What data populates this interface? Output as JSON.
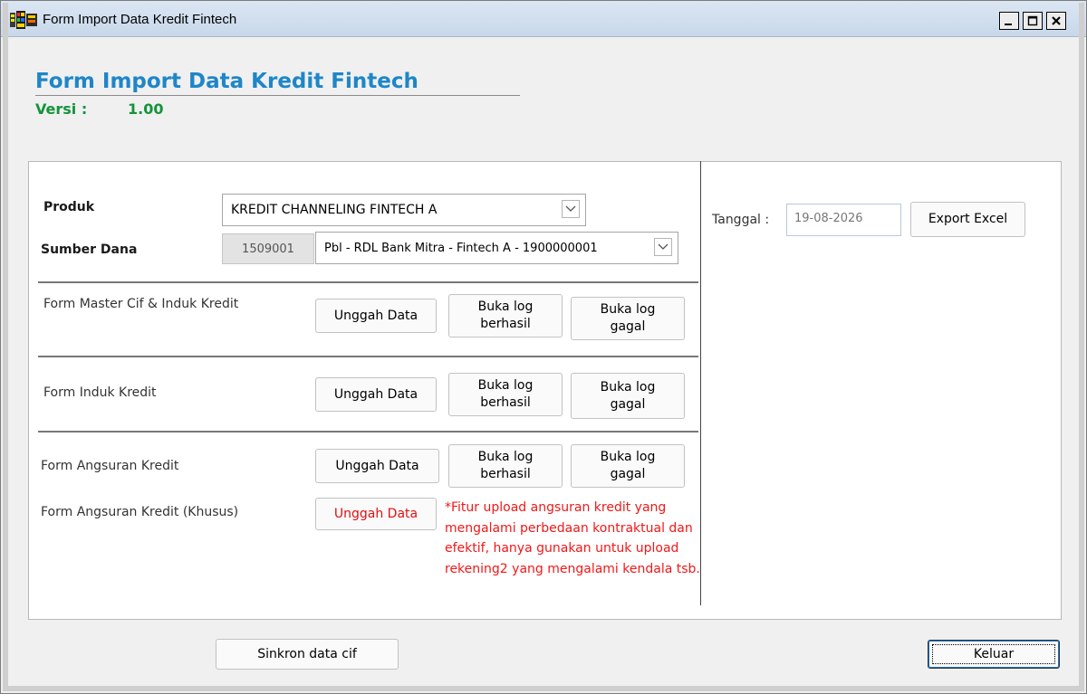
{
  "window": {
    "title": "Form Import Data Kredit Fintech"
  },
  "header": {
    "title": "Form Import Data Kredit Fintech",
    "versi_label": "Versi :",
    "versi_value": "1.00"
  },
  "form": {
    "produk_label": "Produk",
    "produk_value": "KREDIT CHANNELING FINTECH A",
    "sumber_dana_label": "Sumber Dana",
    "sumber_dana_code": "1509001",
    "sumber_dana_value": "Pbl - RDL Bank Mitra - Fintech A - 1900000001"
  },
  "sections": {
    "master": {
      "label": "Form Master Cif & Induk Kredit",
      "upload": "Unggah Data",
      "log_ok_1": "Buka log",
      "log_ok_2": "berhasil",
      "log_fail_1": "Buka log",
      "log_fail_2": "gagal"
    },
    "induk": {
      "label": "Form Induk Kredit",
      "upload": "Unggah Data",
      "log_ok_1": "Buka log",
      "log_ok_2": "berhasil",
      "log_fail_1": "Buka log",
      "log_fail_2": "gagal"
    },
    "angsuran": {
      "label": "Form Angsuran Kredit",
      "upload": "Unggah Data",
      "log_ok_1": "Buka log",
      "log_ok_2": "berhasil",
      "log_fail_1": "Buka log",
      "log_fail_2": "gagal"
    },
    "angsuran_khusus": {
      "label": "Form Angsuran Kredit (Khusus)",
      "upload": "Unggah Data",
      "note": "*Fitur upload angsuran kredit yang mengalami perbedaan kontraktual dan efektif, hanya gunakan untuk upload rekening2 yang mengalami kendala tsb."
    }
  },
  "right": {
    "tanggal_label": "Tanggal :",
    "tanggal_value": "19-08-2026",
    "export_label": "Export Excel"
  },
  "footer": {
    "sinkron_label": "Sinkron data cif",
    "keluar_label": "Keluar"
  },
  "colors": {
    "heading": "#1e86c8",
    "versi": "#14933a",
    "warning": "#f01818"
  }
}
